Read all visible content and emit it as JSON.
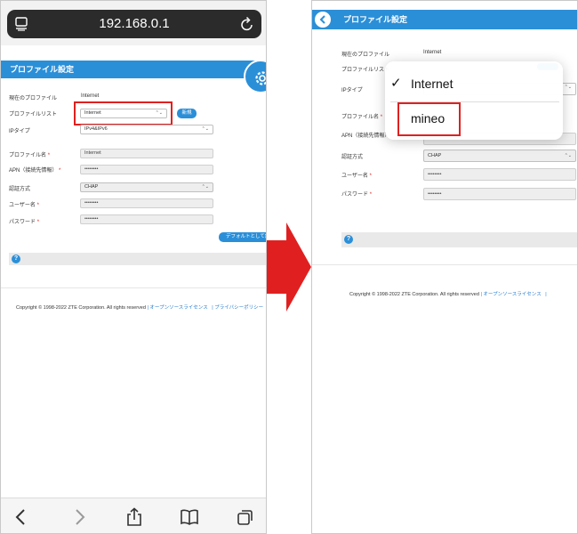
{
  "left": {
    "browser": {
      "url": "192.168.0.1"
    },
    "header": {
      "title": "プロファイル設定"
    },
    "form": {
      "current_profile_label": "現在のプロファイル",
      "current_profile_value": "Internet",
      "profile_list_label": "プロファイルリスト",
      "profile_list_value": "Internet",
      "new_button": "新規",
      "ip_type_label": "IPタイプ",
      "ip_type_value": "IPv4&IPv6",
      "profile_name_label": "プロファイル名",
      "profile_name_value": "Internet",
      "apn_label": "APN（接続先情報）",
      "apn_value": "••••••••",
      "auth_label": "認証方式",
      "auth_value": "CHAP",
      "username_label": "ユーザー名",
      "username_value": "••••••••",
      "password_label": "パスワード",
      "password_value": "••••••••",
      "required_mark": "*",
      "default_button": "デフォルトとして設"
    },
    "help_icon": "?",
    "footer": {
      "copyright": "Copyright © 1998-2022 ZTE Corporation. All rights reserved",
      "sep": "|",
      "oss_link": "オープンソースライセンス",
      "privacy_link": "プライバシーポリシー"
    }
  },
  "right": {
    "header": {
      "title": "プロファイル設定"
    },
    "form": {
      "current_profile_label": "現在のプロファイル",
      "current_profile_value": "Internet",
      "profile_list_label": "プロファイルリスト",
      "ip_type_label": "IPタイプ",
      "profile_name_label": "プロファイル名",
      "apn_label": "APN（接続先情報）",
      "auth_label": "認証方式",
      "auth_value": "CHAP",
      "username_label": "ユーザー名",
      "username_value": "••••••••",
      "password_label": "パスワード",
      "password_value": "••••••••",
      "required_mark": "*"
    },
    "dropdown": {
      "check": "✓",
      "options": [
        "Internet",
        "mineo"
      ]
    },
    "help_icon": "?",
    "footer": {
      "copyright": "Copyright © 1998-2022 ZTE Corporation. All rights reserved",
      "sep": "|",
      "oss_link": "オープンソースライセンス"
    }
  },
  "colors": {
    "accent": "#2b8fd8",
    "highlight": "#e02020",
    "arrow": "#e02020"
  }
}
